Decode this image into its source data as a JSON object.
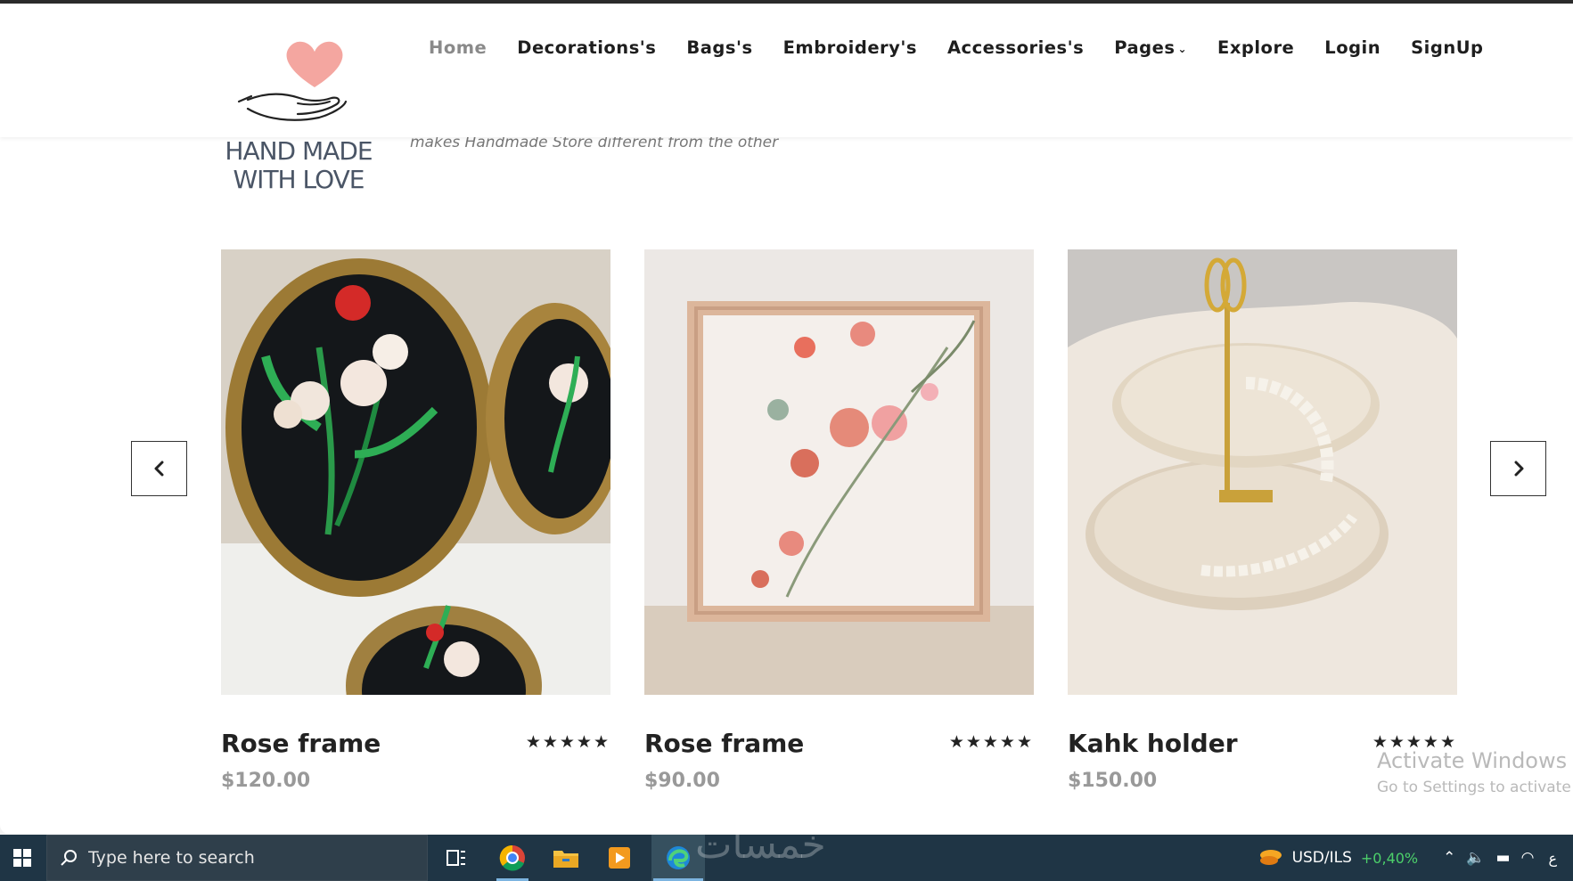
{
  "brand": {
    "logo_text_line1": "HAND MADE",
    "logo_text_line2": "WITH LOVE",
    "logo_heart_color": "#f4a6a0"
  },
  "nav": {
    "items": [
      {
        "label": "Home",
        "active": true
      },
      {
        "label": "Decorations's",
        "active": false
      },
      {
        "label": "Bags's",
        "active": false
      },
      {
        "label": "Embroidery's",
        "active": false
      },
      {
        "label": "Accessories's",
        "active": false
      },
      {
        "label": "Pages",
        "active": false,
        "dropdown": true
      },
      {
        "label": "Explore",
        "active": false
      },
      {
        "label": "Login",
        "active": false
      },
      {
        "label": "SignUp",
        "active": false
      }
    ]
  },
  "tagline": "makes Handmade Store different from the other",
  "carousel": {
    "prev_icon": "chevron-left-icon",
    "next_icon": "chevron-right-icon",
    "products": [
      {
        "title": "Rose frame",
        "price": "$120.00",
        "rating": 5,
        "stars": "★★★★★"
      },
      {
        "title": "Rose frame",
        "price": "$90.00",
        "rating": 5,
        "stars": "★★★★★"
      },
      {
        "title": "Kahk holder",
        "price": "$150.00",
        "rating": 5,
        "stars": "★★★★★"
      }
    ]
  },
  "watermark": {
    "line1": "Activate Windows",
    "line2": "Go to Settings to activate W"
  },
  "taskbar": {
    "search_placeholder": "Type here to search",
    "ticker_pair": "USD/ILS",
    "ticker_change": "+0,40%",
    "lang": "ع",
    "overlay_text": "خمسات"
  },
  "colors": {
    "taskbar": "#1f3545",
    "ticker_change": "#4cd06a",
    "nav_active": "#8a8a8a"
  }
}
